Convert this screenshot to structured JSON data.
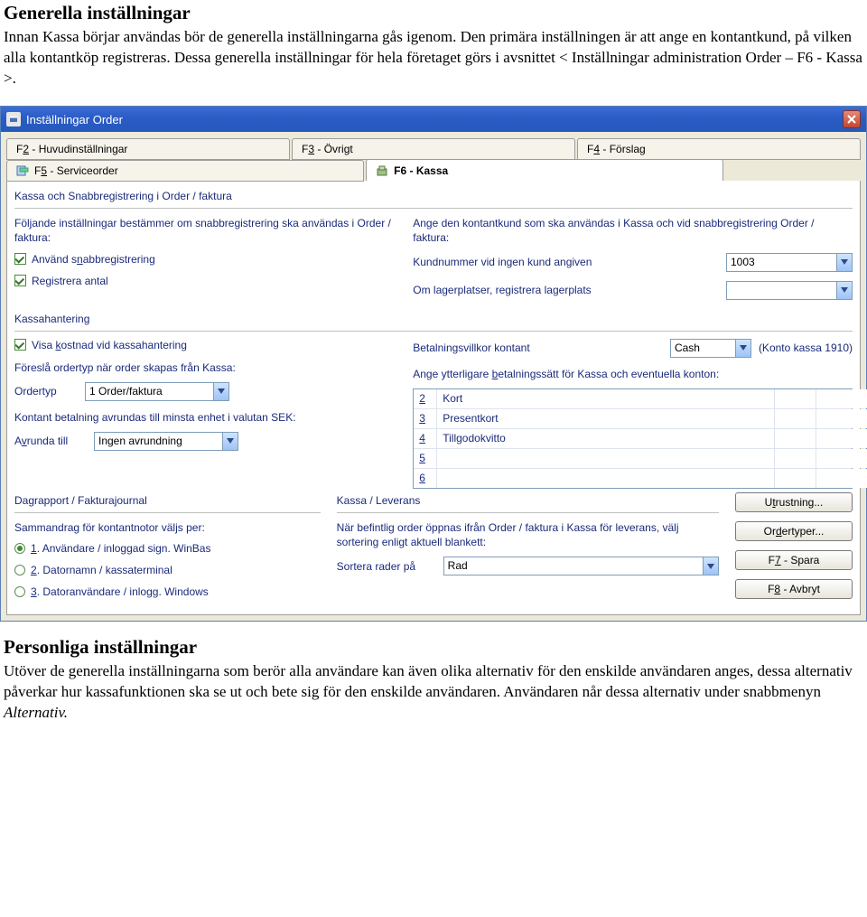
{
  "doc": {
    "title1": "Generella inställningar",
    "para1": "Innan Kassa börjar användas bör de generella inställningarna gås igenom. Den primära inställningen är att ange en kontantkund, på vilken alla kontantköp registreras. Dessa generella inställningar för hela företaget görs i avsnittet < Inställningar administration Order – F6 - Kassa >.",
    "title2": "Personliga inställningar",
    "para2_a": "Utöver de generella inställningarna som berör alla användare kan även olika alternativ för den enskilde användaren anges, dessa alternativ påverkar hur kassafunktionen ska se ut och bete sig för den enskilde användaren. Användaren når dessa alternativ under snabbmenyn ",
    "para2_b": "Alternativ."
  },
  "window": {
    "title": "Inställningar Order",
    "tabs_top": [
      {
        "label_pre": "F",
        "label_acc": "2",
        "label_post": " - Huvudinställningar"
      },
      {
        "label_pre": "F",
        "label_acc": "3",
        "label_post": " - Övrigt"
      },
      {
        "label_pre": "F",
        "label_acc": "4",
        "label_post": " - Förslag"
      }
    ],
    "tabs_bottom": [
      {
        "label_pre": "F",
        "label_acc": "5",
        "label_post": " - Serviceorder",
        "icon": "serviceorder"
      },
      {
        "label_pre": "",
        "label_acc": "",
        "label_post": "F6 - Kassa",
        "icon": "kassa",
        "active": true
      }
    ]
  },
  "panel": {
    "section1_title": "Kassa och Snabbregistrering i Order / faktura",
    "left_desc": "Följande inställningar bestämmer om snabbregistrering ska användas i Order / faktura:",
    "right_desc": "Ange den kontantkund som ska användas i Kassa och vid snabbregistrering Order / faktura:",
    "chk_snabb_pre": "Använd s",
    "chk_snabb_acc": "n",
    "chk_snabb_post": "abbregistrering",
    "chk_antal_pre": "Re",
    "chk_antal_acc": "g",
    "chk_antal_post": "istrera antal",
    "kund_label": "Kundnummer vid ingen kund angiven",
    "kund_value": "1003",
    "lager_label": "Om lagerplatser, registrera lagerplats",
    "lager_value": "",
    "section2_title": "Kassahantering",
    "chk_kost_pre": "Visa ",
    "chk_kost_acc": "k",
    "chk_kost_post": "ostnad vid kassahantering",
    "bet_label": "Betalningsvillkor kontant",
    "bet_value": "Cash",
    "bet_konto": "(Konto kassa 1910)",
    "ordertyp_desc": "Föreslå ordertyp när order skapas från Kassa:",
    "ordertyp_label": "Ordertyp",
    "ordertyp_value": "1  Order/faktura",
    "extra_bet_desc_pre": "Ange ytterligare ",
    "extra_bet_desc_acc": "b",
    "extra_bet_desc_post": "etalningssätt för Kassa och eventuella konton:",
    "pay_rows": [
      {
        "num": "2",
        "name": "Kort"
      },
      {
        "num": "3",
        "name": "Presentkort"
      },
      {
        "num": "4",
        "name": "Tillgodokvitto"
      },
      {
        "num": "5",
        "name": ""
      },
      {
        "num": "6",
        "name": ""
      }
    ],
    "avr_desc": "Kontant betalning avrundas till minsta enhet i valutan SEK:",
    "avr_label_pre": "A",
    "avr_label_acc": "v",
    "avr_label_post": "runda till",
    "avr_value": "Ingen avrundning",
    "dagr_title": "Dagrapport / Fakturajournal",
    "dagr_desc": "Sammandrag för kontantnotor väljs per:",
    "dagr_opt1_acc": "1",
    "dagr_opt1_post": ". Användare / inloggad sign. WinBas",
    "dagr_opt2_acc": "2",
    "dagr_opt2_post": ". Datornamn / kassaterminal",
    "dagr_opt3_acc": "3",
    "dagr_opt3_post": ". Datoranvändare / inlogg. Windows",
    "kl_title": "Kassa / Leverans",
    "kl_desc": "När befintlig order öppnas ifrån Order / faktura i  Kassa för leverans, välj sortering enligt aktuell blankett:",
    "kl_label": "Sortera rader på",
    "kl_value": "Rad",
    "btn_utr_pre": "U",
    "btn_utr_acc": "t",
    "btn_utr_post": "rustning...",
    "btn_ot_pre": "Or",
    "btn_ot_acc": "d",
    "btn_ot_post": "ertyper...",
    "btn_f7_pre": "F",
    "btn_f7_acc": "7",
    "btn_f7_post": " - Spara",
    "btn_f8_pre": "F",
    "btn_f8_acc": "8",
    "btn_f8_post": " - Avbryt"
  }
}
